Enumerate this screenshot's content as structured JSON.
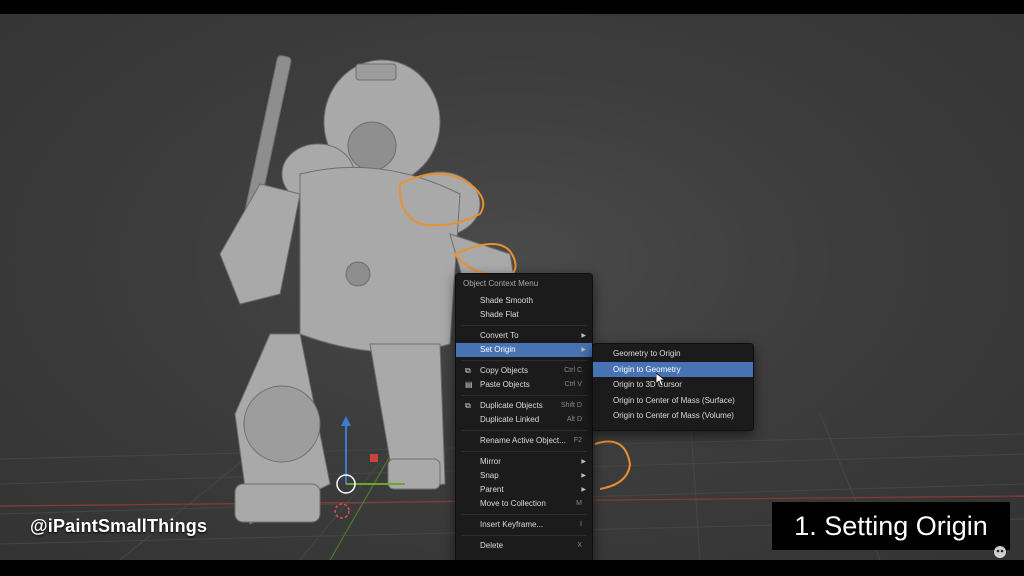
{
  "context_menu": {
    "title": "Object Context Menu",
    "items": [
      {
        "label": "Shade Smooth",
        "shortcut": "",
        "submenu": false,
        "icon": ""
      },
      {
        "label": "Shade Flat",
        "shortcut": "",
        "submenu": false,
        "icon": ""
      },
      {
        "label": "Convert To",
        "shortcut": "",
        "submenu": true,
        "icon": ""
      },
      {
        "label": "Set Origin",
        "shortcut": "",
        "submenu": true,
        "icon": ""
      },
      {
        "label": "Copy Objects",
        "shortcut": "Ctrl C",
        "submenu": false,
        "icon": "copy-icon"
      },
      {
        "label": "Paste Objects",
        "shortcut": "Ctrl V",
        "submenu": false,
        "icon": "paste-icon"
      },
      {
        "label": "Duplicate Objects",
        "shortcut": "Shift D",
        "submenu": false,
        "icon": "duplicate-icon"
      },
      {
        "label": "Duplicate Linked",
        "shortcut": "Alt D",
        "submenu": false,
        "icon": ""
      },
      {
        "label": "Rename Active Object...",
        "shortcut": "F2",
        "submenu": false,
        "icon": ""
      },
      {
        "label": "Mirror",
        "shortcut": "",
        "submenu": true,
        "icon": ""
      },
      {
        "label": "Snap",
        "shortcut": "",
        "submenu": true,
        "icon": ""
      },
      {
        "label": "Parent",
        "shortcut": "",
        "submenu": true,
        "icon": ""
      },
      {
        "label": "Move to Collection",
        "shortcut": "M",
        "submenu": false,
        "icon": ""
      },
      {
        "label": "Insert Keyframe...",
        "shortcut": "I",
        "submenu": false,
        "icon": ""
      },
      {
        "label": "Delete",
        "shortcut": "X",
        "submenu": false,
        "icon": ""
      }
    ],
    "active_item": "Set Origin"
  },
  "set_origin_submenu": {
    "items": [
      "Geometry to Origin",
      "Origin to Geometry",
      "Origin to 3D Cursor",
      "Origin to Center of Mass (Surface)",
      "Origin to Center of Mass (Volume)"
    ],
    "highlighted": "Origin to Geometry"
  },
  "overlay": {
    "watermark": "@iPaintSmallThings",
    "caption": "1. Setting Origin"
  },
  "colors": {
    "viewport_bg": "#3d3d3d",
    "menu_bg": "#1b1b1b",
    "highlight": "#4772b3",
    "selection_outline": "#e8912e",
    "axis_x": "#c8453f",
    "axis_y": "#6aa52c",
    "axis_z": "#3b7bd6"
  }
}
